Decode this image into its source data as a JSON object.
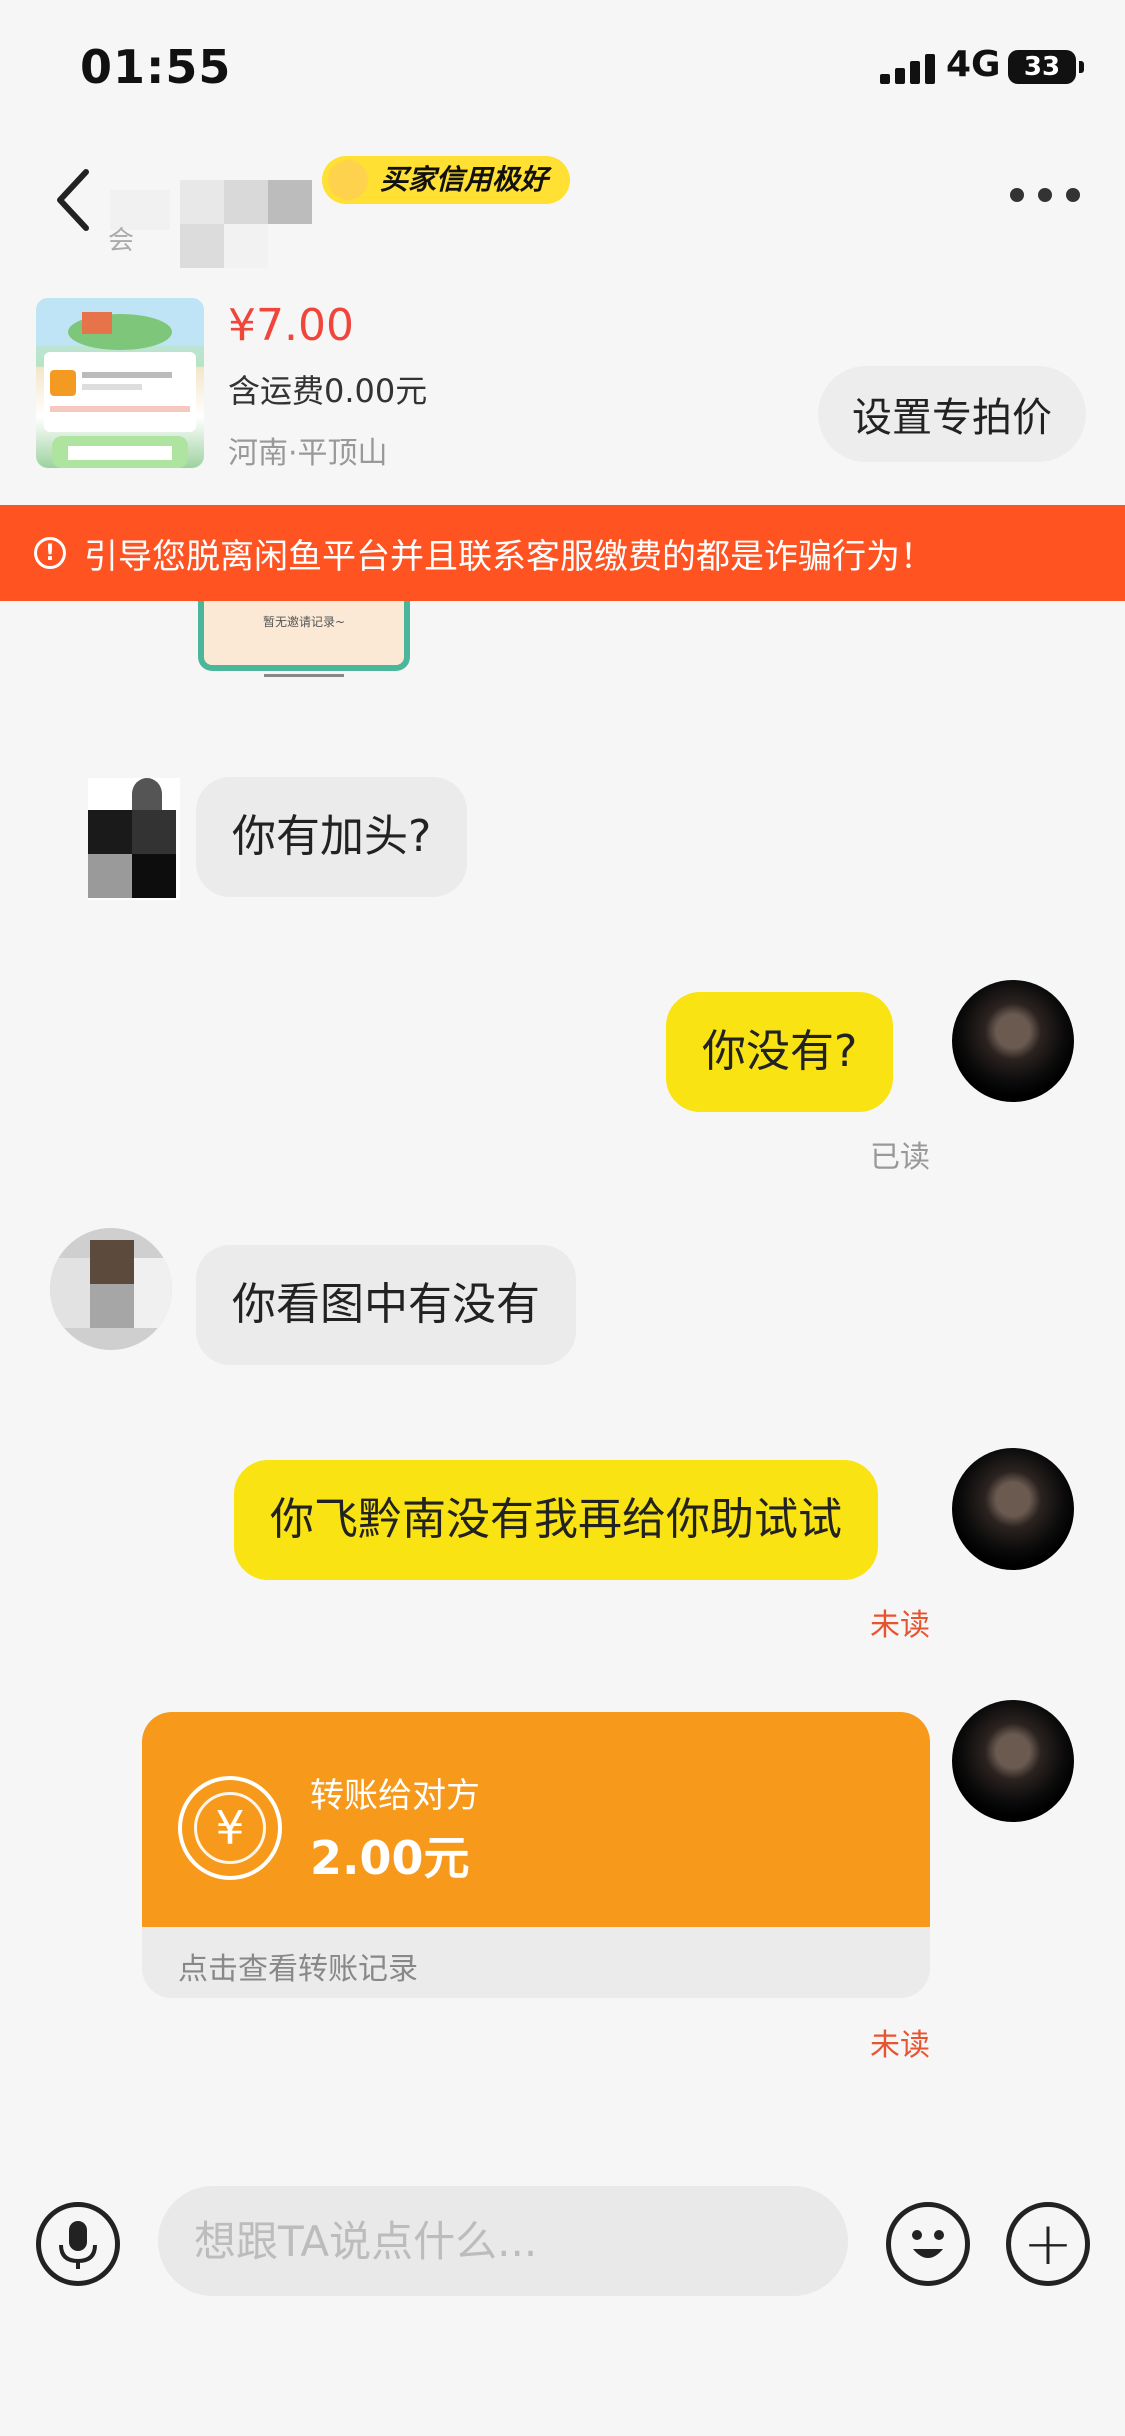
{
  "status_bar": {
    "time": "01:55",
    "network": "4G",
    "battery": "33"
  },
  "header": {
    "contact_sub": "会",
    "credit_badge": "买家信用极好",
    "icons": [
      "back-icon",
      "more-icon"
    ]
  },
  "product": {
    "price": "¥7.00",
    "shipping": "含运费0.00元",
    "location": "河南·平顶山",
    "set_price_button": "设置专拍价"
  },
  "warning": {
    "text": "引导您脱离闲鱼平台并且联系客服缴费的都是诈骗行为！"
  },
  "partial_card_text": "暂无邀请记录~",
  "messages": [
    {
      "side": "in",
      "text": "你有加头?"
    },
    {
      "side": "out",
      "text": "你没有?",
      "status": "已读"
    },
    {
      "side": "in",
      "text": "你看图中有没有"
    },
    {
      "side": "out",
      "text": "你飞黔南没有我再给你助试试",
      "status": "未读"
    }
  ],
  "transfer": {
    "title": "转账给对方",
    "amount": "2.00元",
    "footer": "点击查看转账记录",
    "status": "未读"
  },
  "input": {
    "placeholder": "想跟TA说点什么..."
  },
  "colors": {
    "accent_yellow": "#f9e312",
    "warning_red": "#ff5322",
    "price_red": "#f0453a",
    "transfer_orange": "#f7991a",
    "unread_red": "#e8542f"
  }
}
